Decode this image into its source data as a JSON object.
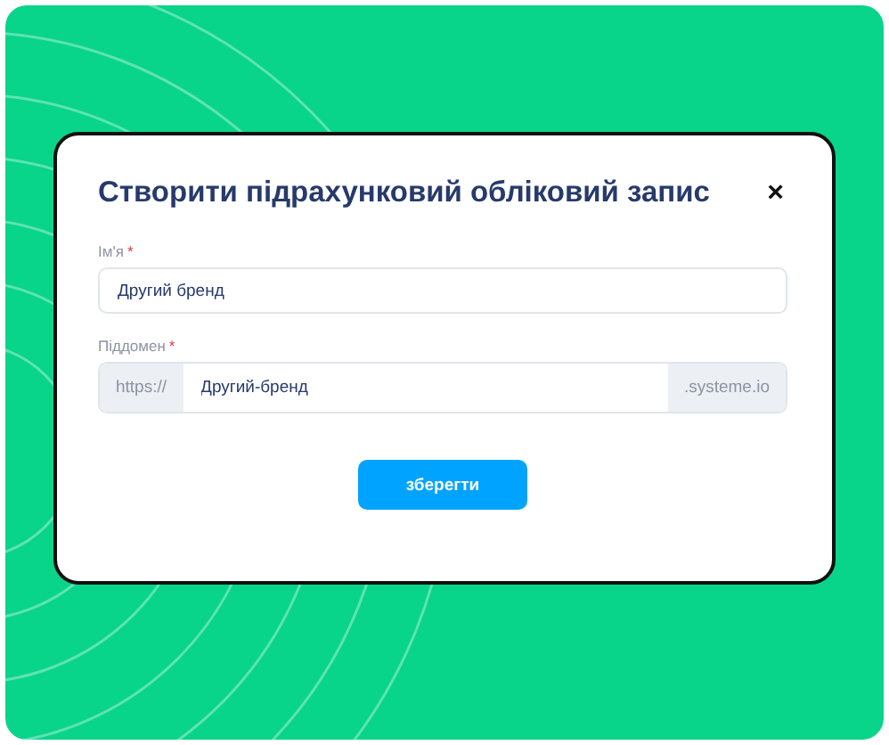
{
  "modal": {
    "title": "Створити підрахунковий обліковий запис",
    "close": "×",
    "fields": [
      {
        "kind": "text",
        "label": "Ім'я",
        "required_mark": "*",
        "value": "Другий бренд"
      },
      {
        "kind": "subdomain",
        "label": "Піддомен",
        "required_mark": "*",
        "prefix": "https://",
        "value": "Другий-бренд",
        "suffix": ".systeme.io"
      }
    ],
    "button": "зберегти"
  }
}
